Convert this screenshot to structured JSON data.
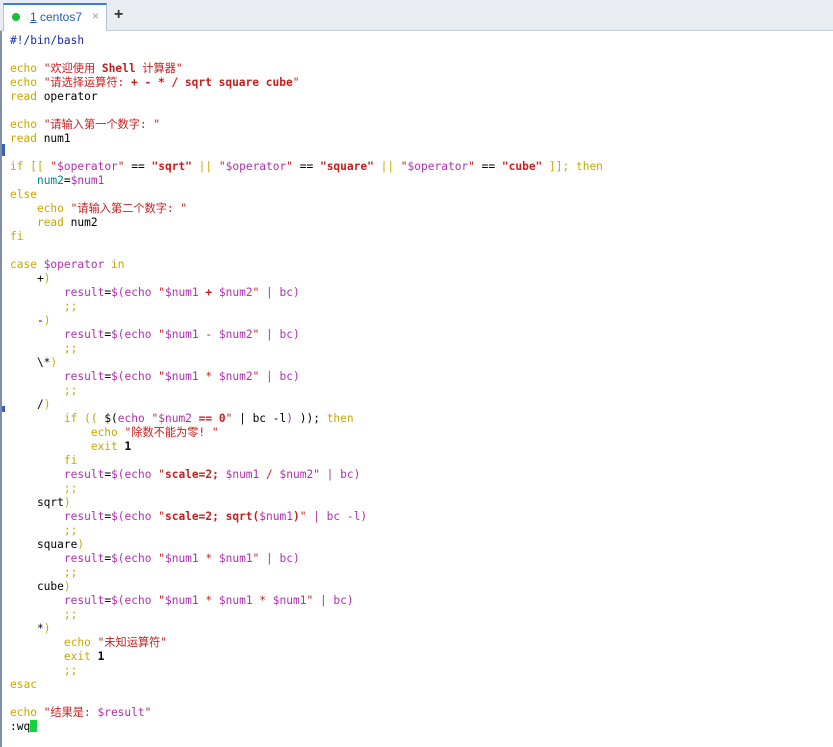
{
  "tab": {
    "number": "1",
    "name": "centos7",
    "close": "×",
    "status_color": "#15c03a"
  },
  "add_tab": "+",
  "terminal": {
    "lines": [
      [
        [
          "sh",
          "#!/bin/bash"
        ]
      ],
      [],
      [
        [
          "k",
          "echo "
        ],
        [
          "s",
          "\"欢迎使用 "
        ],
        [
          "s b",
          "Shell"
        ],
        [
          "s",
          " 计算器\""
        ]
      ],
      [
        [
          "k",
          "echo "
        ],
        [
          "s",
          "\"请选择运算符: "
        ],
        [
          "s b",
          "+ - * / sqrt square cube"
        ],
        [
          "s",
          "\""
        ]
      ],
      [
        [
          "k",
          "read "
        ],
        [
          "n",
          "operator"
        ]
      ],
      [],
      [
        [
          "k",
          "echo "
        ],
        [
          "s",
          "\"请输入第一个数字: \""
        ]
      ],
      [
        [
          "k",
          "read "
        ],
        [
          "n",
          "num1"
        ]
      ],
      [],
      [
        [
          "k",
          "if [[ "
        ],
        [
          "s",
          "\""
        ],
        [
          "v",
          "$operator"
        ],
        [
          "s",
          "\""
        ],
        [
          "n",
          " == "
        ],
        [
          "s b",
          "\"sqrt\""
        ],
        [
          "k",
          " || "
        ],
        [
          "s",
          "\""
        ],
        [
          "v",
          "$operator"
        ],
        [
          "s",
          "\""
        ],
        [
          "n",
          " == "
        ],
        [
          "s b",
          "\"square\""
        ],
        [
          "k",
          " || "
        ],
        [
          "s",
          "\""
        ],
        [
          "v",
          "$operator"
        ],
        [
          "s",
          "\""
        ],
        [
          "n",
          " == "
        ],
        [
          "s b",
          "\"cube\""
        ],
        [
          "k",
          " ]]; then"
        ]
      ],
      [
        [
          "n",
          "    "
        ],
        [
          "vc",
          "num2"
        ],
        [
          "n",
          "="
        ],
        [
          "v",
          "$num1"
        ]
      ],
      [
        [
          "k",
          "else"
        ]
      ],
      [
        [
          "n",
          "    "
        ],
        [
          "k",
          "echo "
        ],
        [
          "s",
          "\"请输入第二个数字: \""
        ]
      ],
      [
        [
          "n",
          "    "
        ],
        [
          "k",
          "read "
        ],
        [
          "n",
          "num2"
        ]
      ],
      [
        [
          "k",
          "fi"
        ]
      ],
      [],
      [
        [
          "k",
          "case "
        ],
        [
          "v",
          "$operator"
        ],
        [
          "k",
          " in"
        ]
      ],
      [
        [
          "n",
          "    +"
        ],
        [
          "k",
          ")"
        ]
      ],
      [
        [
          "n",
          "        "
        ],
        [
          "v",
          "result"
        ],
        [
          "n",
          "="
        ],
        [
          "v",
          "$(echo "
        ],
        [
          "s",
          "\""
        ],
        [
          "v",
          "$num1"
        ],
        [
          "s b",
          " + "
        ],
        [
          "v",
          "$num2"
        ],
        [
          "s",
          "\""
        ],
        [
          "v",
          " | bc)"
        ]
      ],
      [
        [
          "n",
          "        "
        ],
        [
          "k",
          ";;"
        ]
      ],
      [
        [
          "n",
          "    -"
        ],
        [
          "k",
          ")"
        ]
      ],
      [
        [
          "n",
          "        "
        ],
        [
          "v",
          "result"
        ],
        [
          "n",
          "="
        ],
        [
          "v",
          "$(echo "
        ],
        [
          "s",
          "\""
        ],
        [
          "v",
          "$num1"
        ],
        [
          "s",
          " - "
        ],
        [
          "v",
          "$num2"
        ],
        [
          "s",
          "\""
        ],
        [
          "v",
          " | bc)"
        ]
      ],
      [
        [
          "n",
          "        "
        ],
        [
          "k",
          ";;"
        ]
      ],
      [
        [
          "n",
          "    \\*"
        ],
        [
          "k",
          ")"
        ]
      ],
      [
        [
          "n",
          "        "
        ],
        [
          "v",
          "result"
        ],
        [
          "n",
          "="
        ],
        [
          "v",
          "$(echo "
        ],
        [
          "s",
          "\""
        ],
        [
          "v",
          "$num1"
        ],
        [
          "s",
          " * "
        ],
        [
          "v",
          "$num2"
        ],
        [
          "s",
          "\""
        ],
        [
          "v",
          " | bc)"
        ]
      ],
      [
        [
          "n",
          "        "
        ],
        [
          "k",
          ";;"
        ]
      ],
      [
        [
          "n",
          "    /"
        ],
        [
          "k",
          ")"
        ]
      ],
      [
        [
          "n",
          "        "
        ],
        [
          "k",
          "if (( "
        ],
        [
          "n",
          "$("
        ],
        [
          "v",
          "echo "
        ],
        [
          "s",
          "\""
        ],
        [
          "v",
          "$num2"
        ],
        [
          "s b",
          " == 0"
        ],
        [
          "s",
          "\""
        ],
        [
          "n",
          " | bc -l"
        ],
        [
          "v",
          ")"
        ],
        [
          "n",
          " )); "
        ],
        [
          "k",
          "then"
        ]
      ],
      [
        [
          "n",
          "            "
        ],
        [
          "k",
          "echo "
        ],
        [
          "s",
          "\"除数不能为零! \""
        ]
      ],
      [
        [
          "n",
          "            "
        ],
        [
          "k",
          "exit "
        ],
        [
          "n b",
          "1"
        ]
      ],
      [
        [
          "n",
          "        "
        ],
        [
          "k",
          "fi"
        ]
      ],
      [
        [
          "n",
          "        "
        ],
        [
          "v",
          "result"
        ],
        [
          "n",
          "="
        ],
        [
          "v",
          "$(echo "
        ],
        [
          "s",
          "\""
        ],
        [
          "s b",
          "scale=2; "
        ],
        [
          "v",
          "$num1"
        ],
        [
          "s",
          " / "
        ],
        [
          "v",
          "$num2"
        ],
        [
          "s",
          "\""
        ],
        [
          "v",
          " | bc)"
        ]
      ],
      [
        [
          "n",
          "        "
        ],
        [
          "k",
          ";;"
        ]
      ],
      [
        [
          "n",
          "    sqrt"
        ],
        [
          "k",
          ")"
        ]
      ],
      [
        [
          "n",
          "        "
        ],
        [
          "v",
          "result"
        ],
        [
          "n",
          "="
        ],
        [
          "v",
          "$(echo "
        ],
        [
          "s",
          "\""
        ],
        [
          "s b",
          "scale=2; sqrt("
        ],
        [
          "v",
          "$num1"
        ],
        [
          "s b",
          ")"
        ],
        [
          "s",
          "\""
        ],
        [
          "v",
          " | bc -l)"
        ]
      ],
      [
        [
          "n",
          "        "
        ],
        [
          "k",
          ";;"
        ]
      ],
      [
        [
          "n",
          "    square"
        ],
        [
          "k",
          ")"
        ]
      ],
      [
        [
          "n",
          "        "
        ],
        [
          "v",
          "result"
        ],
        [
          "n",
          "="
        ],
        [
          "v",
          "$(echo "
        ],
        [
          "s",
          "\""
        ],
        [
          "v",
          "$num1"
        ],
        [
          "s",
          " * "
        ],
        [
          "v",
          "$num1"
        ],
        [
          "s",
          "\""
        ],
        [
          "v",
          " | bc)"
        ]
      ],
      [
        [
          "n",
          "        "
        ],
        [
          "k",
          ";;"
        ]
      ],
      [
        [
          "n",
          "    cube"
        ],
        [
          "k",
          ")"
        ]
      ],
      [
        [
          "n",
          "        "
        ],
        [
          "v",
          "result"
        ],
        [
          "n",
          "="
        ],
        [
          "v",
          "$(echo "
        ],
        [
          "s",
          "\""
        ],
        [
          "v",
          "$num1"
        ],
        [
          "s",
          " * "
        ],
        [
          "v",
          "$num1"
        ],
        [
          "s",
          " * "
        ],
        [
          "v",
          "$num1"
        ],
        [
          "s",
          "\""
        ],
        [
          "v",
          " | bc)"
        ]
      ],
      [
        [
          "n",
          "        "
        ],
        [
          "k",
          ";;"
        ]
      ],
      [
        [
          "n",
          "    *"
        ],
        [
          "k",
          ")"
        ]
      ],
      [
        [
          "n",
          "        "
        ],
        [
          "k",
          "echo "
        ],
        [
          "s",
          "\"未知运算符\""
        ]
      ],
      [
        [
          "n",
          "        "
        ],
        [
          "k",
          "exit "
        ],
        [
          "n b",
          "1"
        ]
      ],
      [
        [
          "n",
          "        "
        ],
        [
          "k",
          ";;"
        ]
      ],
      [
        [
          "k",
          "esac"
        ]
      ],
      [],
      [
        [
          "k",
          "echo "
        ],
        [
          "s",
          "\"结果是: "
        ],
        [
          "v",
          "$result"
        ],
        [
          "s",
          "\""
        ]
      ],
      [
        [
          "n",
          ":wq"
        ]
      ]
    ]
  }
}
